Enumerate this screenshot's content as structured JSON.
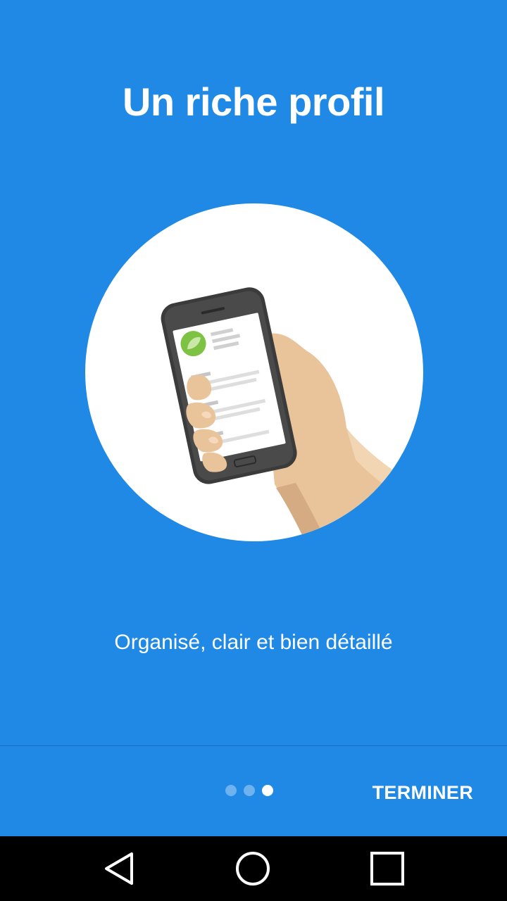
{
  "onboarding": {
    "title": "Un riche profil",
    "subtitle": "Organisé, clair et bien détaillé",
    "page_indicator": {
      "total": 3,
      "current": 3
    },
    "done_label": "TERMINER"
  },
  "illustration": {
    "icon": "hand-holding-phone-illustration",
    "accent_color": "#7dc242"
  },
  "system_nav": {
    "back_icon": "back-triangle-icon",
    "home_icon": "home-circle-icon",
    "recents_icon": "recents-square-icon"
  },
  "colors": {
    "background": "#1f89e5",
    "text": "#ffffff",
    "navbar": "#000000"
  }
}
